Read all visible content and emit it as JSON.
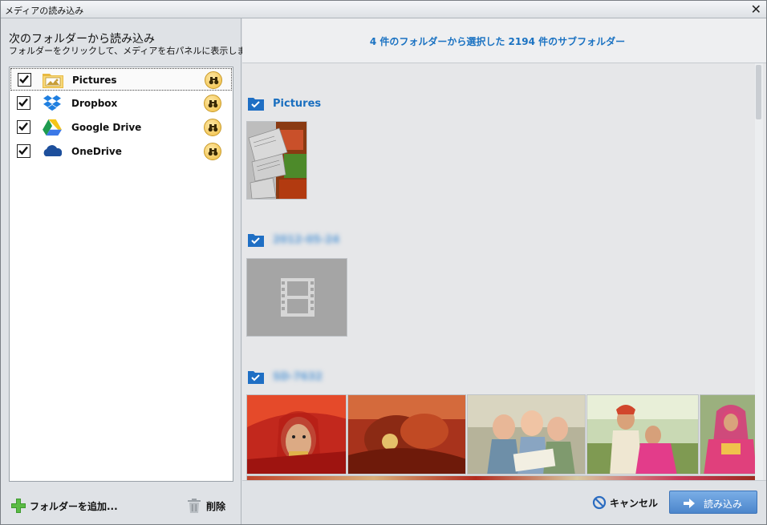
{
  "window": {
    "title": "メディアの読み込み",
    "close_symbol": "✕"
  },
  "left": {
    "heading": "次のフォルダーから読み込み",
    "subheading": "フォルダーをクリックして、メディアを右パネルに表示します",
    "folders": [
      {
        "label": "Pictures",
        "checked": true,
        "icon": "pictures-folder-icon"
      },
      {
        "label": "Dropbox",
        "checked": true,
        "icon": "dropbox-icon"
      },
      {
        "label": "Google Drive",
        "checked": true,
        "icon": "google-drive-icon"
      },
      {
        "label": "OneDrive",
        "checked": true,
        "icon": "onedrive-icon"
      }
    ],
    "add_folder_label": "フォルダーを追加...",
    "delete_label": "削除"
  },
  "right": {
    "summary": "4 件のフォルダーから選択した 2194 件のサブフォルダー",
    "groups": [
      {
        "name": "Pictures"
      },
      {
        "name": "2012-05-24"
      },
      {
        "name": "SD-7632"
      }
    ]
  },
  "footer": {
    "cancel_label": "キャンセル",
    "import_label": "読み込み"
  },
  "colors": {
    "accent": "#1a72c2",
    "import_button": "#5a92d4"
  }
}
